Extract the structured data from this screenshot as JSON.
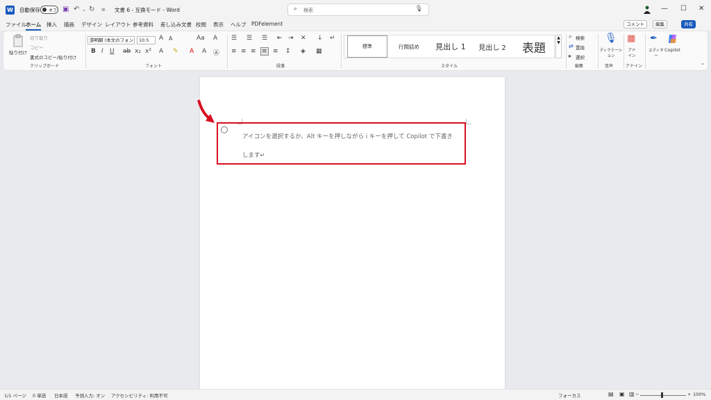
{
  "titlebar": {
    "app_logo": "W",
    "autosave_label": "自動保存",
    "autosave_state": "オフ",
    "doc_title": "文書 6 - 互換モード - Word",
    "search_placeholder": "検索"
  },
  "menu": {
    "items": [
      "ファイル",
      "ホーム",
      "挿入",
      "描画",
      "デザイン",
      "レイアウト",
      "参考資料",
      "差し込み文書",
      "校閲",
      "表示",
      "ヘルプ",
      "PDFelement"
    ],
    "active": "ホーム",
    "comment_label": "コメント",
    "edit_label": "編集",
    "share_label": "共有"
  },
  "ribbon": {
    "clipboard": {
      "paste_label": "貼り付け",
      "cut_label": "切り取り",
      "copy_label": "コピー",
      "format_painter_label": "書式のコピー/貼り付け",
      "group_label": "クリップボード"
    },
    "font": {
      "font_name": "游明朝 (本文のフォン",
      "font_size": "10.5",
      "group_label": "フォント"
    },
    "paragraph": {
      "group_label": "段落"
    },
    "styles": {
      "items": [
        "標準",
        "行間詰め",
        "見出し 1",
        "見出し 2",
        "表題"
      ],
      "group_label": "スタイル"
    },
    "editing": {
      "find_label": "検索",
      "replace_label": "置換",
      "select_label": "選択",
      "group_label": "編集"
    },
    "voice": {
      "dictate_label": "ディクテーション",
      "group_label": "音声"
    },
    "addins": {
      "addins_label": "アドイン",
      "group_label": "アドイン"
    },
    "editor_label": "エディター",
    "copilot_label": "Copilot"
  },
  "document": {
    "hint_line1": "アイコンを選択するか、Alt キーを押しながら i キーを押して Copilot で下書き",
    "hint_line2": "します↵"
  },
  "status": {
    "page": "1/1 ページ",
    "words": "0 単語",
    "language": "日本語",
    "prediction": "予測入力: オン",
    "accessibility": "アクセシビリティ: 利用不可",
    "focus": "フォーカス",
    "zoom": "100%"
  },
  "colors": {
    "accent": "#185abd",
    "highlight_box": "#d80f1f"
  }
}
